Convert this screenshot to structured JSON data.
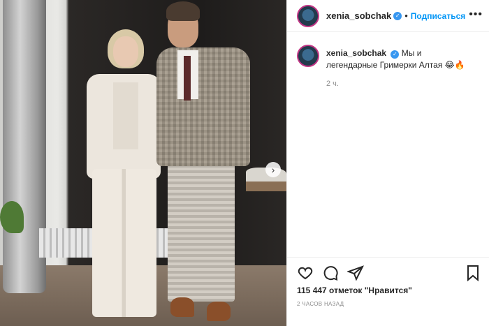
{
  "post": {
    "username": "xenia_sobchak",
    "follow_label": "Подписаться",
    "separator": "•",
    "more": "•••",
    "caption": "Мы и легендарные Гримерки Алтая 😂🔥",
    "caption_time": "2 ч.",
    "likes": "115 447 отметок \"Нравится\"",
    "posted_ago": "2 ЧАСОВ НАЗАД",
    "next_arrow": "›",
    "verified_mark": "✓"
  },
  "icons": {
    "like": "heart-icon",
    "comment": "comment-icon",
    "share": "share-icon",
    "save": "bookmark-icon",
    "next": "chevron-right-icon"
  },
  "colors": {
    "accent": "#0095f6",
    "verified": "#3897f0",
    "text": "#262626",
    "muted": "#8e8e8e"
  }
}
